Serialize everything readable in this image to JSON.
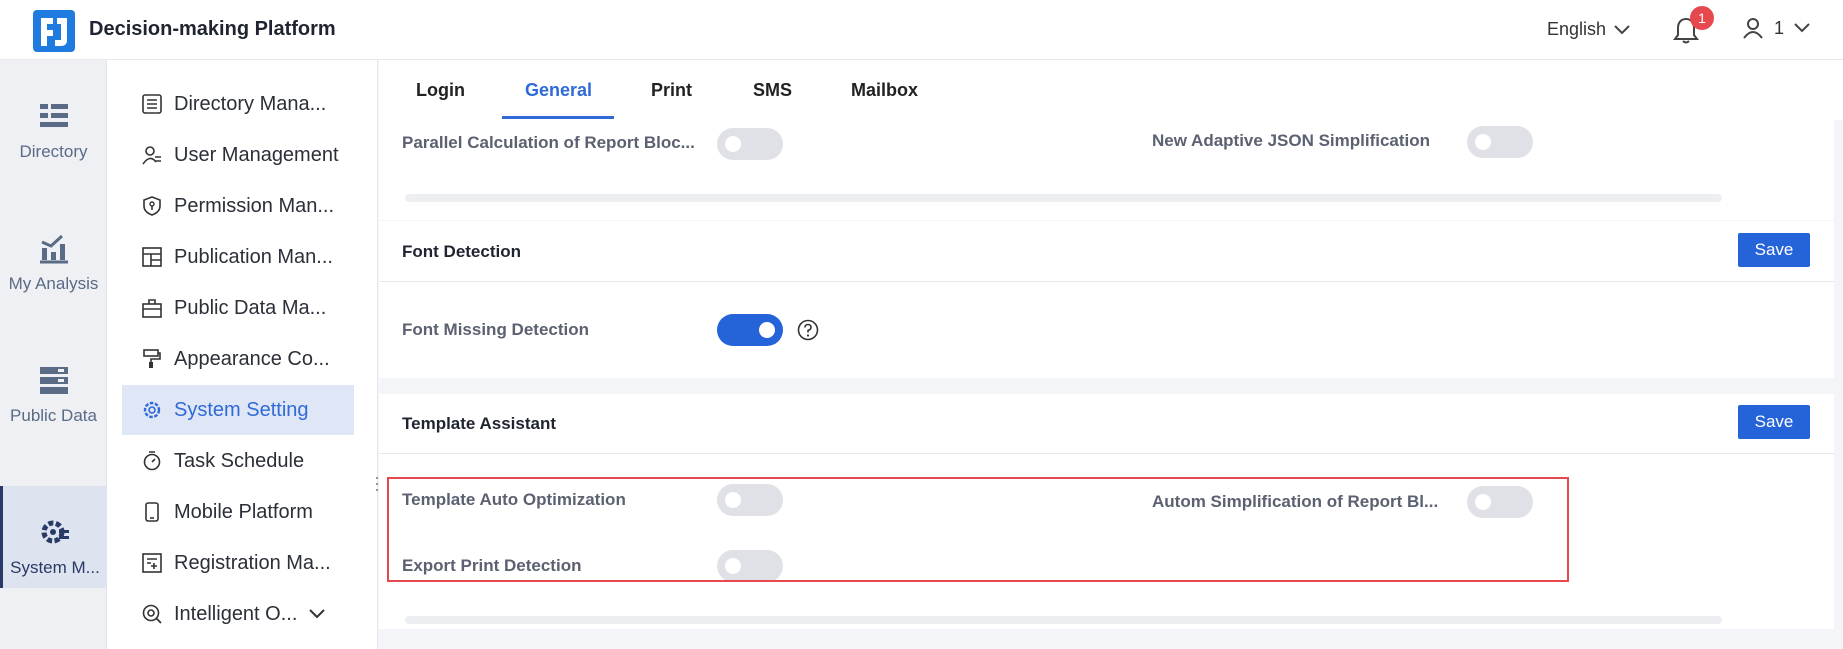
{
  "header": {
    "app_title": "Decision-making Platform",
    "language": "English",
    "notification_count": "1",
    "user_name": "1"
  },
  "rail": {
    "items": [
      {
        "label": "Directory",
        "icon": "list-icon"
      },
      {
        "label": "My Analysis",
        "icon": "analysis-chart-icon"
      },
      {
        "label": "Public Data",
        "icon": "database-icon"
      },
      {
        "label": "System M...",
        "icon": "gear-settings-icon",
        "active": true
      }
    ]
  },
  "submenu": {
    "items": [
      {
        "label": "Directory Mana..."
      },
      {
        "label": "User Management"
      },
      {
        "label": "Permission Man..."
      },
      {
        "label": "Publication Man..."
      },
      {
        "label": "Public Data Ma..."
      },
      {
        "label": "Appearance Co..."
      },
      {
        "label": "System Setting"
      },
      {
        "label": "Task Schedule"
      },
      {
        "label": "Mobile Platform"
      },
      {
        "label": "Registration Ma..."
      },
      {
        "label": "Intelligent O..."
      }
    ]
  },
  "tabs": [
    "Login",
    "General",
    "Print",
    "SMS",
    "Mailbox"
  ],
  "active_tab": "General",
  "sections": {
    "top": {
      "left_label": "Parallel Calculation of Report Bloc...",
      "right_label": "New Adaptive JSON Simplification"
    },
    "font_detection": {
      "title": "Font Detection",
      "save_label": "Save",
      "font_missing_label": "Font Missing Detection"
    },
    "template_assistant": {
      "title": "Template Assistant",
      "save_label": "Save",
      "auto_optimization_label": "Template Auto Optimization",
      "auto_simplification_label": "Autom Simplification of Report Bl...",
      "export_print_label": "Export Print Detection"
    }
  },
  "colors": {
    "accent": "#2563d9",
    "highlight": "#e5484d",
    "badge": "#e5484d"
  }
}
